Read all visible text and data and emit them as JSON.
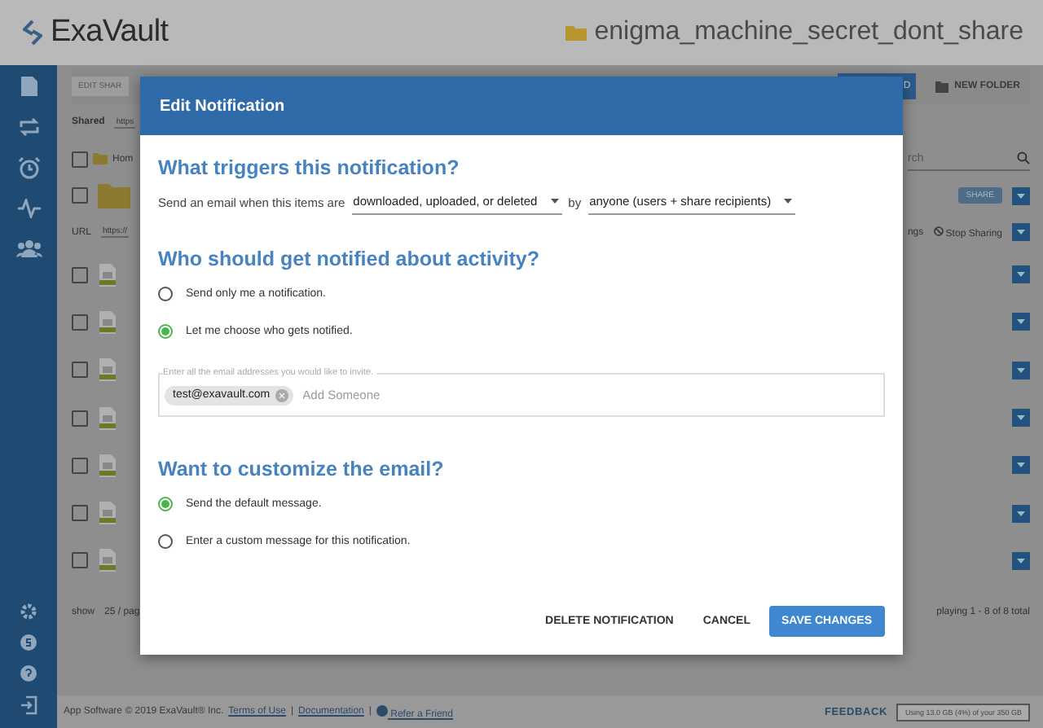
{
  "header": {
    "logo": "ExaVault",
    "folder_title": "enigma_machine_secret_dont_share"
  },
  "toolbar": {
    "edit_share": "EDIT SHAR",
    "upload": "D",
    "new_folder": "NEW FOLDER"
  },
  "share_info": {
    "label": "Shared",
    "url": "https"
  },
  "breadcrumb": {
    "label": "Hom",
    "search_placeholder": "rch",
    "checked": false
  },
  "share_row": {
    "badge": "SHARE",
    "checked": false
  },
  "url_row": {
    "label": "URL",
    "url": "https://",
    "settings": "ngs",
    "stop_sharing": "Stop Sharing"
  },
  "file_rows": [
    {
      "checked": false
    },
    {
      "checked": false
    },
    {
      "checked": false
    },
    {
      "checked": false
    },
    {
      "checked": false
    },
    {
      "checked": false
    },
    {
      "checked": false
    }
  ],
  "pager": {
    "show": "show",
    "page_size": "25 / pag",
    "summary": "playing 1 - 8 of 8 total"
  },
  "footer": {
    "items": [
      {
        "kind": "text",
        "text": "App Software © 2019 ExaVault® Inc."
      },
      {
        "kind": "link",
        "text": "Terms of Use"
      },
      {
        "kind": "text",
        "text": "|"
      },
      {
        "kind": "link",
        "text": "Documentation"
      },
      {
        "kind": "text",
        "text": "|"
      },
      {
        "kind": "link",
        "text": "Refer a Friend"
      }
    ],
    "feedback": "FEEDBACK",
    "usage": "Using 13.0 GB (4%) of your 350 GB"
  },
  "modal": {
    "title": "Edit Notification",
    "sections": [
      {
        "kind": "trigger",
        "heading": "What triggers this notification?",
        "lead": "Send an email when this items are",
        "event_select": "downloaded, uploaded, or deleted",
        "by": "by",
        "audience_select": "anyone (users + share recipients)"
      },
      {
        "kind": "radios",
        "heading": "Who should get notified about activity?",
        "options": [
          {
            "label": "Send only me a notification.",
            "selected": false
          },
          {
            "label": "Let me choose who gets notified.",
            "selected": true
          }
        ]
      },
      {
        "kind": "recipients",
        "label": "Enter all the email addresses you would like to invite.",
        "chips": [
          "test@exavault.com"
        ],
        "placeholder": "Add Someone"
      },
      {
        "kind": "radios",
        "heading": "Want to customize the email?",
        "options": [
          {
            "label": "Send the default message.",
            "selected": true
          },
          {
            "label": "Enter a custom message for this notification.",
            "selected": false
          }
        ]
      }
    ],
    "buttons": [
      {
        "label": "DELETE NOTIFICATION",
        "kind": "text"
      },
      {
        "label": "CANCEL",
        "kind": "text"
      },
      {
        "label": "SAVE CHANGES",
        "kind": "primary"
      }
    ]
  }
}
